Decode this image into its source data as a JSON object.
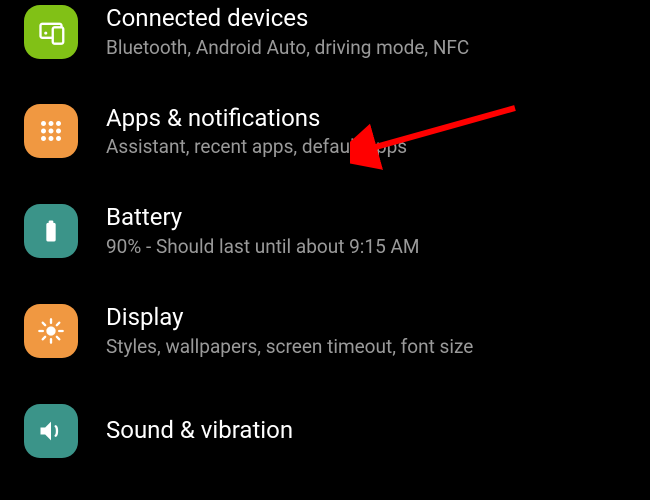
{
  "settings": [
    {
      "title": "Connected devices",
      "subtitle": "Bluetooth, Android Auto, driving mode, NFC",
      "icon": "devices-icon",
      "color": "#81c116"
    },
    {
      "title": "Apps & notifications",
      "subtitle": "Assistant, recent apps, default apps",
      "icon": "apps-icon",
      "color": "#f09841"
    },
    {
      "title": "Battery",
      "subtitle": "90% - Should last until about 9:15 AM",
      "icon": "battery-icon",
      "color": "#3b9489"
    },
    {
      "title": "Display",
      "subtitle": "Styles, wallpapers, screen timeout, font size",
      "icon": "display-icon",
      "color": "#f09841"
    },
    {
      "title": "Sound & vibration",
      "subtitle": "",
      "icon": "sound-icon",
      "color": "#3b9489"
    }
  ],
  "annotation": {
    "type": "arrow",
    "color": "#ff0000",
    "target": "apps-notifications"
  }
}
